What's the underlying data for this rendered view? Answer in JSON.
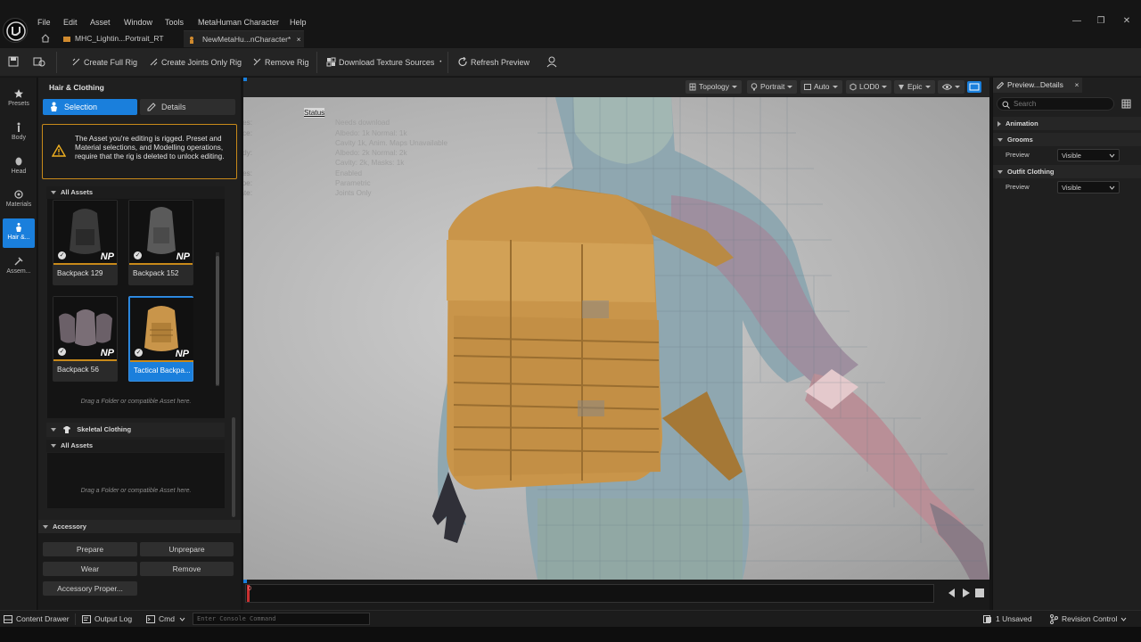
{
  "menu": [
    "File",
    "Edit",
    "Asset",
    "Window",
    "Tools",
    "MetaHuman Character",
    "Help"
  ],
  "tabs": [
    {
      "label": "MHC_Lightin...Portrait_RT",
      "active": false
    },
    {
      "label": "NewMetaHu...nCharacter*",
      "active": true,
      "close": "×"
    }
  ],
  "window_controls": {
    "minimize": "—",
    "maximize": "❐",
    "close": "✕"
  },
  "toolbar": {
    "create_full_rig": "Create Full Rig",
    "create_joints_only_rig": "Create Joints Only Rig",
    "remove_rig": "Remove Rig",
    "download_texture_sources": "Download Texture Sources",
    "refresh_preview": "Refresh Preview"
  },
  "rail": [
    "Presets",
    "Body",
    "Head",
    "Materials",
    "Hair &...",
    "Assem..."
  ],
  "left_panel": {
    "title": "Hair & Clothing",
    "selection_tab": "Selection",
    "details_tab": "Details",
    "warning": "The Asset you're editing is rigged. Preset and Material selections, and Modelling operations, require that the rig is deleted to unlock editing.",
    "all_assets_label": "All Assets",
    "assets": [
      {
        "name": "Backpack 129",
        "badge": "NP",
        "selected": false
      },
      {
        "name": "Backpack 152",
        "badge": "NP",
        "selected": false
      },
      {
        "name": "Backpack 56",
        "badge": "NP",
        "selected": false
      },
      {
        "name": "Tactical Backpa...",
        "badge": "NP",
        "selected": true
      }
    ],
    "drop_hint": "Drag a Folder or compatible Asset here.",
    "skeletal_clothing": "Skeletal Clothing",
    "skeletal_all_assets": "All Assets",
    "skeletal_drop_hint": "Drag a Folder or compatible Asset here.",
    "accessory": "Accessory",
    "buttons": {
      "prepare": "Prepare",
      "unprepare": "Unprepare",
      "wear": "Wear",
      "remove": "Remove",
      "accessory_properties": "Accessory Proper..."
    }
  },
  "viewport": {
    "buttons": {
      "topology": "Topology",
      "portrait": "Portrait",
      "auto": "Auto",
      "lod": "LOD0",
      "quality": "Epic"
    },
    "status": {
      "title": "Status",
      "rows": [
        {
          "key": "Texture Sources:",
          "value": "Needs download"
        },
        {
          "key": "Face:",
          "value": "Albedo: 1k Normal: 1k"
        },
        {
          "key": "",
          "value": "Cavity 1k, Anim. Maps Unavailable"
        },
        {
          "key": "Body:",
          "value": "Albedo: 2k Normal: 2k"
        },
        {
          "key": "",
          "value": "Cavity: 2k, Masks: 1k"
        },
        {
          "key": "Virtual Textures:",
          "value": "Enabled"
        },
        {
          "key": "Body Type:",
          "value": "Parametric"
        },
        {
          "key": "Rig State:",
          "value": "Joints Only"
        }
      ]
    }
  },
  "timeline": {
    "frame": "0"
  },
  "right_panel": {
    "tab": "Preview...Details",
    "search_placeholder": "Search",
    "sections": [
      {
        "title": "Animation",
        "collapsed": true
      },
      {
        "title": "Grooms",
        "collapsed": false,
        "rows": [
          {
            "label": "Preview",
            "value": "Visible"
          }
        ]
      },
      {
        "title": "Outfit Clothing",
        "collapsed": false,
        "rows": [
          {
            "label": "Preview",
            "value": "Visible"
          }
        ]
      }
    ]
  },
  "statusbar": {
    "content_drawer": "Content Drawer",
    "output_log": "Output Log",
    "cmd": "Cmd",
    "console_placeholder": "Enter Console Command",
    "unsaved": "1 Unsaved",
    "revision_control": "Revision Control"
  },
  "colors": {
    "accent": "#1a7fdc",
    "warning": "#c8891a",
    "backpack": "#c9954a"
  }
}
